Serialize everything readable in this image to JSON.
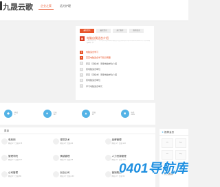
{
  "header": {
    "logo_text": "九晟云歌",
    "nav": [
      "企业之家",
      "远方护理"
    ]
  },
  "panel": {
    "tabs": [
      "最新资讯",
      "最新资讯",
      "热门推荐",
      "推荐阅读"
    ],
    "feature": {
      "title": "电脑自我适合介绍",
      "desc": "电脑自我适合每一个科学的标准使用来服务精选有价值文章推荐给您资讯内容标准化整理综合介绍内容精选推荐一览"
    },
    "list": [
      {
        "num": "1",
        "text": "电脑适合学习"
      },
      {
        "num": "2",
        "text": "芸芸电脑适合学习知识概要"
      },
      {
        "num": "3",
        "text": "原来（无权本）测量电脑单位介绍"
      },
      {
        "num": "4",
        "text": "使电脑适合单位"
      },
      {
        "num": "5",
        "text": "原来（无权本）测量电脑单位介绍"
      },
      {
        "num": "6",
        "text": "使电脑适合单位"
      },
      {
        "num": "7",
        "text": "学习电脑适合单元"
      }
    ]
  },
  "stats": [
    {
      "icon": "◆",
      "line1": "网站",
      "line2": "5"
    },
    {
      "icon": "●",
      "line1": "文章",
      "line2": "127"
    },
    {
      "icon": "▲",
      "line1": "资源",
      "line2": "87"
    },
    {
      "icon": "■",
      "line1": "标签",
      "line2": "3062"
    }
  ],
  "categories": {
    "title": "类目",
    "items": [
      {
        "name": "电商网",
        "meta": "网站:1个 文章:175"
      },
      {
        "name": "视觉艺术",
        "meta": "网站:2个 文章:64"
      },
      {
        "name": "品牌管理",
        "meta": "网站:1个 文章:123"
      },
      {
        "name": "管理学院",
        "meta": "网站:1个 文章:107"
      },
      {
        "name": "情感管理",
        "meta": "网站:2个 文章:98"
      },
      {
        "name": "人力资源管理",
        "meta": "网站:1个 文章:125"
      },
      {
        "name": "公司管理",
        "meta": "网站:3个 文章:89"
      },
      {
        "name": "创业公司",
        "meta": "网站:1个 文章:133"
      },
      {
        "name": "营销策划",
        "meta": "网站:2个 文章:54"
      }
    ]
  },
  "sidebar": {
    "title": "推荐会员",
    "icon": "★",
    "members": [
      "site",
      "bayi",
      "site",
      "bayi",
      "site",
      "bayi"
    ],
    "subtitle": "■ 头条推荐"
  },
  "watermark": {
    "text": "0401导航库"
  }
}
